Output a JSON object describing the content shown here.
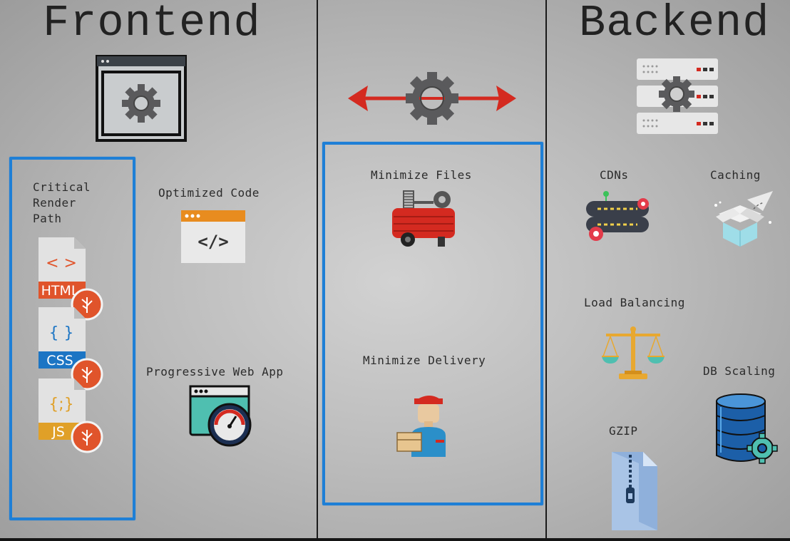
{
  "frontend": {
    "title": "Frontend",
    "critical_render_path": "Critical Render Path",
    "optimized_code": "Optimized Code",
    "progressive_web_app": "Progressive Web App",
    "files": [
      {
        "name": "HTML",
        "symbol": "< >",
        "color": "#e0542b"
      },
      {
        "name": "CSS",
        "symbol": "{ }",
        "color": "#1c75c4"
      },
      {
        "name": "JS",
        "symbol": "{;}",
        "color": "#e0a028"
      }
    ],
    "code_symbol": "</>"
  },
  "middle": {
    "minimize_files": "Minimize Files",
    "minimize_delivery": "Minimize Delivery"
  },
  "backend": {
    "title": "Backend",
    "cdns": "CDNs",
    "caching": "Caching",
    "load_balancing": "Load Balancing",
    "db_scaling": "DB Scaling",
    "gzip": "GZIP"
  },
  "colors": {
    "highlight_box": "#1e7fd6",
    "arrow": "#d42a20",
    "gear": "#5a5a5c",
    "divider": "#1a1a1a"
  },
  "icons": [
    "browser-gear-icon",
    "double-arrow-gear-icon",
    "server-gear-icon",
    "html-file-icon",
    "css-file-icon",
    "js-file-icon",
    "code-window-icon",
    "pwa-speedometer-icon",
    "air-compressor-icon",
    "delivery-man-icon",
    "cdn-network-icon",
    "caching-box-icon",
    "balance-scale-icon",
    "database-gear-icon",
    "zip-file-icon"
  ]
}
